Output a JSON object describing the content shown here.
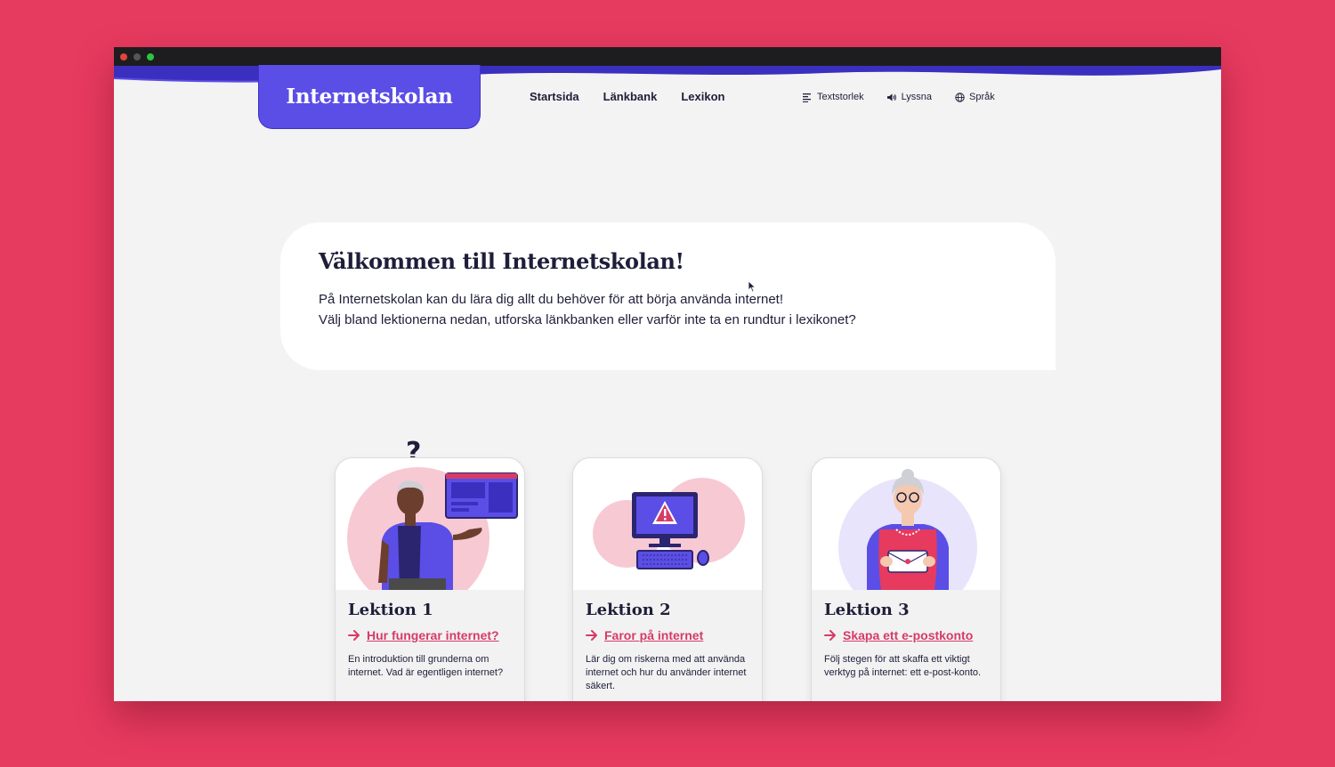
{
  "site": {
    "logo": "Internetskolan"
  },
  "nav": [
    {
      "label": "Startsida"
    },
    {
      "label": "Länkbank"
    },
    {
      "label": "Lexikon"
    }
  ],
  "tools": [
    {
      "label": "Textstorlek",
      "icon": "text-size-icon"
    },
    {
      "label": "Lyssna",
      "icon": "speaker-icon"
    },
    {
      "label": "Språk",
      "icon": "globe-icon"
    }
  ],
  "welcome": {
    "title": "Välkommen till Internetskolan!",
    "line1": "På Internetskolan kan du lära dig allt du behöver för att börja använda internet!",
    "line2": "Välj bland lektionerna nedan, utforska länkbanken eller varför inte ta en rundtur i lexikonet?"
  },
  "lessons": [
    {
      "title": "Lektion 1",
      "link": "Hur fungerar internet?",
      "description": "En introduktion till grunderna om internet. Vad är egentligen internet?",
      "question_mark": "?"
    },
    {
      "title": "Lektion 2",
      "link": "Faror på internet",
      "description": "Lär dig om riskerna med att använda internet och hur du använder internet säkert."
    },
    {
      "title": "Lektion 3",
      "link": "Skapa ett e-postkonto",
      "description": "Följ stegen för att skaffa ett viktigt verktyg på internet: ett e-post-konto."
    }
  ],
  "colors": {
    "background": "#e73a5f",
    "brand": "#5b4ee6",
    "link": "#d63b67",
    "text": "#1e1e3a"
  }
}
